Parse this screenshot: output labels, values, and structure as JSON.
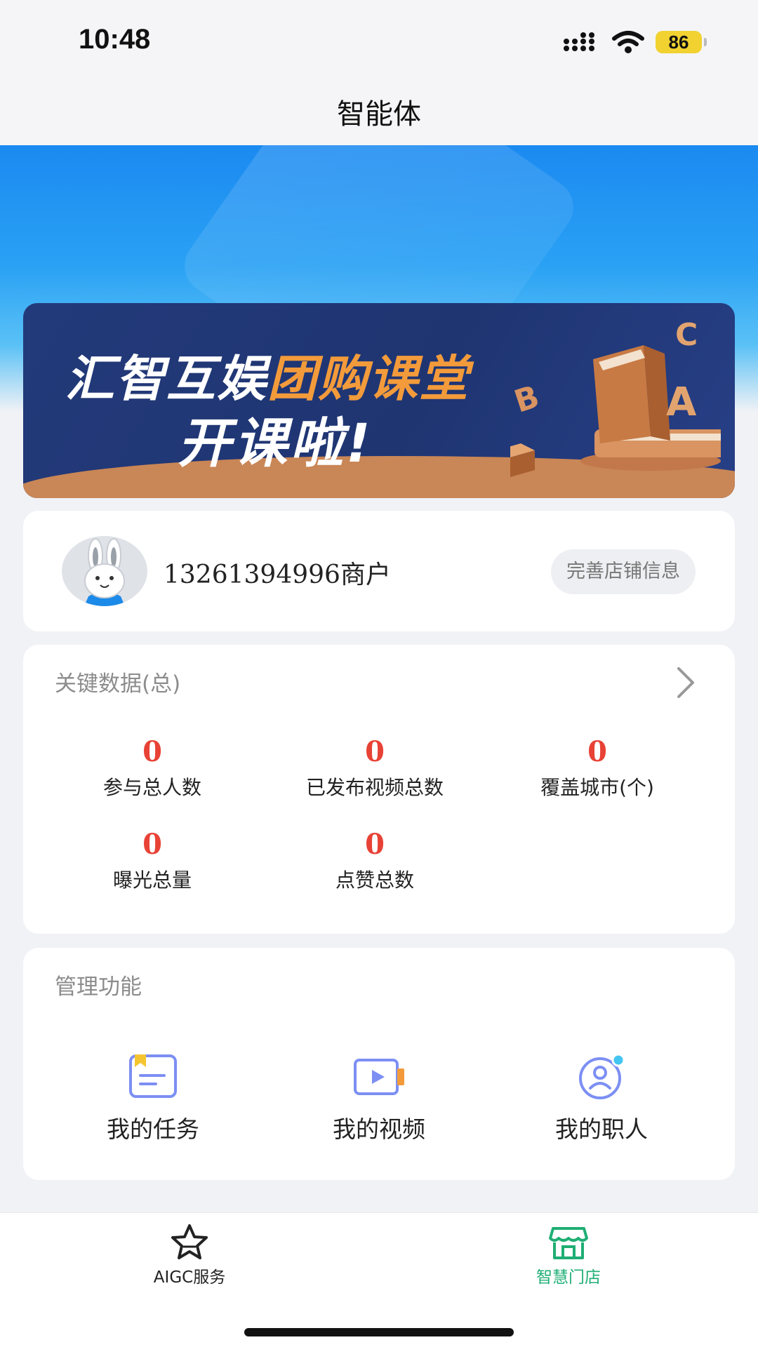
{
  "status_bar": {
    "time": "10:48",
    "battery": "86"
  },
  "nav": {
    "title": "智能体"
  },
  "banner": {
    "line1_white": "汇智互娱",
    "line1_orange": "团购课堂",
    "line2": "开课啦!",
    "letters": [
      "B",
      "A",
      "C"
    ]
  },
  "merchant": {
    "name": "13261394996商户",
    "action_label": "完善店铺信息"
  },
  "key_data": {
    "title": "关键数据(总)",
    "stats": [
      {
        "value": "0",
        "label": "参与总人数"
      },
      {
        "value": "0",
        "label": "已发布视频总数"
      },
      {
        "value": "0",
        "label": "覆盖城市(个)"
      },
      {
        "value": "0",
        "label": "曝光总量"
      },
      {
        "value": "0",
        "label": "点赞总数"
      }
    ]
  },
  "management": {
    "title": "管理功能",
    "items": [
      {
        "label": "我的任务",
        "icon": "task-icon"
      },
      {
        "label": "我的视频",
        "icon": "video-icon"
      },
      {
        "label": "我的职人",
        "icon": "person-icon"
      }
    ]
  },
  "tab_bar": {
    "items": [
      {
        "label": "AIGC服务",
        "icon": "star-icon",
        "active": false
      },
      {
        "label": "智慧门店",
        "icon": "store-icon",
        "active": true
      }
    ],
    "active_color": "#1fae74",
    "inactive_color": "#222222"
  },
  "colors": {
    "accent_red": "#e84236",
    "banner_orange": "#f39b3b",
    "icon_blue": "#7c8ff3",
    "icon_yellow": "#f5c531"
  }
}
